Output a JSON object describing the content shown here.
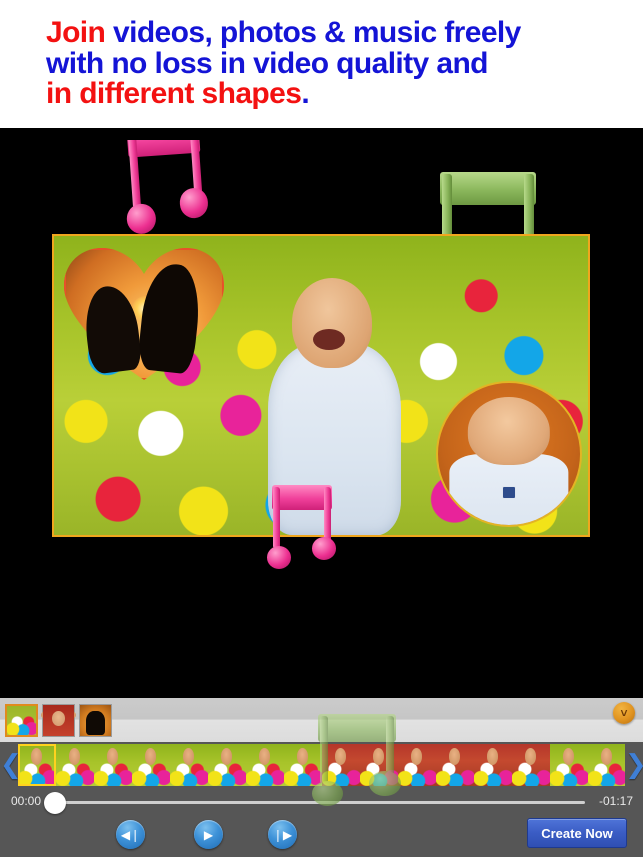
{
  "headline": {
    "line1_red": "Join ",
    "line1_blue": "videos, photos & music freely",
    "line2_blue": "with no loss in video quality and",
    "line3_red": "in different shapes",
    "line3_blue": "."
  },
  "colors": {
    "headline_red": "#f31111",
    "headline_blue": "#1414d6",
    "stage_background": "#000000",
    "frame_border": "#f0a61e",
    "selected_thumb_border": "#e08a1e",
    "selected_frame_border": "#ffd21e",
    "create_button": "#3a5cc4",
    "transport_button": "#3e92d8",
    "collapse_button": "#e09320",
    "strip_arrow": "#3f7fd6",
    "note_pink": "#ec2f90",
    "note_green": "#83b154"
  },
  "preview": {
    "notes": [
      {
        "name": "music-note-pink-top",
        "color": "pink"
      },
      {
        "name": "music-note-green-right",
        "color": "green"
      },
      {
        "name": "music-note-pink-bottom",
        "color": "pink"
      }
    ],
    "heart_overlay_label": "heart-shape-overlay",
    "circle_overlay_label": "circle-shape-overlay"
  },
  "editor": {
    "collapse_icon": "˅",
    "asset_thumbnails": [
      {
        "name": "asset-thumb-video",
        "selected": true
      },
      {
        "name": "asset-thumb-photo-1",
        "selected": false
      },
      {
        "name": "asset-thumb-photo-2",
        "selected": false
      }
    ],
    "filmstrip": {
      "prev_arrow_icon": "❮",
      "next_arrow_icon": "❯",
      "frame_count": 16,
      "selected_frame_index": 0
    },
    "scrubber": {
      "current_time": "00:00",
      "remaining_time": "-01:17",
      "position_percent": 0
    },
    "transport": [
      {
        "name": "previous-button",
        "icon": "◀❘"
      },
      {
        "name": "play-button",
        "icon": "▶"
      },
      {
        "name": "next-button",
        "icon": "❘▶"
      }
    ],
    "create_label": "Create Now"
  }
}
